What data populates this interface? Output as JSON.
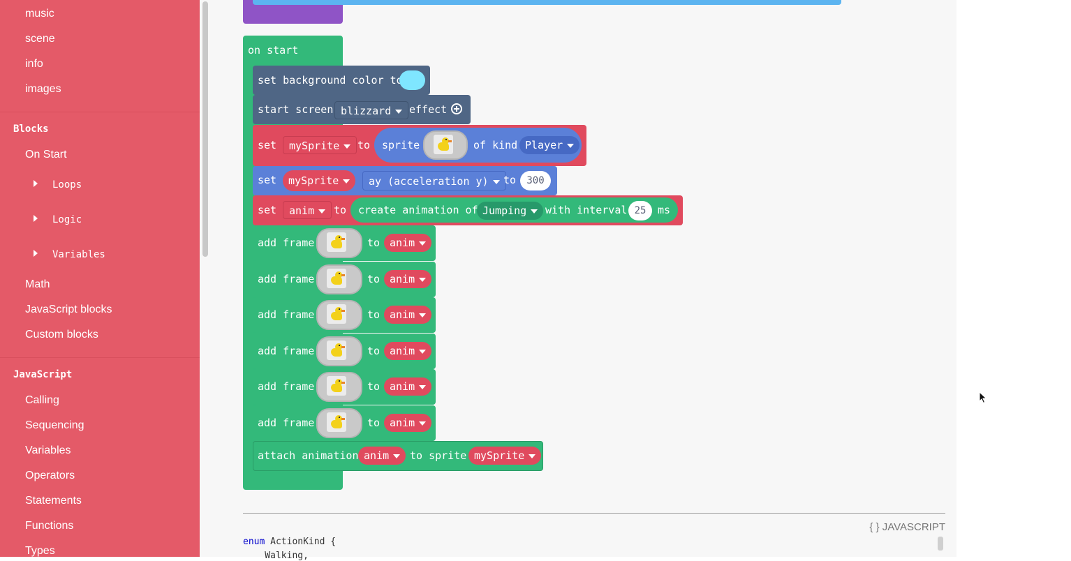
{
  "sidebar": {
    "items_top": [
      "music",
      "scene",
      "info",
      "images"
    ],
    "blocks_heading": "Blocks",
    "blocks_items": {
      "on_start": "On Start",
      "loops": "Loops",
      "logic": "Logic",
      "variables": "Variables",
      "math": "Math",
      "js_blocks": "JavaScript blocks",
      "custom": "Custom blocks"
    },
    "js_heading": "JavaScript",
    "js_items": [
      "Calling",
      "Sequencing",
      "Variables",
      "Operators",
      "Statements",
      "Functions",
      "Types"
    ]
  },
  "blocks": {
    "hat": "on start",
    "bg": {
      "label": "set background color to",
      "color": "#7fe6ff"
    },
    "effect": {
      "label1": "start screen",
      "value": "blizzard",
      "label2": "effect"
    },
    "set_sprite": {
      "set": "set",
      "var": "mySprite",
      "to": "to",
      "sprite": "sprite",
      "ofkind": "of kind",
      "kind": "Player"
    },
    "set_ay": {
      "set": "set",
      "var": "mySprite",
      "prop": "ay (acceleration y)",
      "to": "to",
      "value": "300"
    },
    "set_anim": {
      "set": "set",
      "var": "anim",
      "to": "to",
      "create": "create animation of",
      "action": "Jumping",
      "interval_label": "with interval",
      "interval": "25",
      "unit": "ms"
    },
    "add_frame": {
      "label": "add frame",
      "to": "to",
      "var": "anim"
    },
    "attach": {
      "label": "attach animation",
      "anim": "anim",
      "to": "to sprite",
      "sprite": "mySprite"
    }
  },
  "code": {
    "header": "{ } JAVASCRIPT",
    "line1_kw": "enum",
    "line1_rest": " ActionKind {",
    "line2": "    Walking,"
  },
  "colors": {
    "sidebar": "#e45a68",
    "green": "#33b97a",
    "red": "#e04a5e",
    "blue": "#5b80d8",
    "slate": "#4f6685",
    "purple": "#8f54c6"
  }
}
